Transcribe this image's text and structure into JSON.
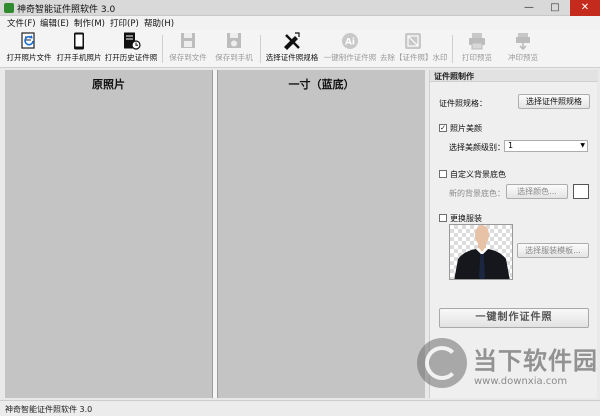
{
  "window": {
    "title": "神奇智能证件照软件 3.0",
    "minimize": "—",
    "maximize": "□",
    "close": "✕"
  },
  "menu": [
    "文件(F)",
    "编辑(E)",
    "制作(M)",
    "打印(P)",
    "帮助(H)"
  ],
  "toolbar": [
    {
      "label": "打开照片文件",
      "icon": "open-photo-file-icon",
      "enabled": true
    },
    {
      "label": "打开手机照片",
      "icon": "phone-icon",
      "enabled": true
    },
    {
      "label": "打开历史证件照",
      "icon": "history-document-icon",
      "enabled": true
    },
    {
      "label": "保存到文件",
      "icon": "floppy-disk-icon",
      "enabled": false
    },
    {
      "label": "保存到手机",
      "icon": "save-to-phone-icon",
      "enabled": false
    },
    {
      "label": "选择证件照规格",
      "icon": "ruler-pencil-icon",
      "enabled": true
    },
    {
      "label": "一键制作证件照",
      "icon": "ai-icon",
      "enabled": false
    },
    {
      "label": "去除【证件照】水印",
      "icon": "remove-watermark-icon",
      "enabled": false
    },
    {
      "label": "打印预览",
      "icon": "printer-icon",
      "enabled": false
    },
    {
      "label": "冲印预览",
      "icon": "print-shop-icon",
      "enabled": false
    }
  ],
  "panes": {
    "left_title": "原照片",
    "middle_title": "一寸（蓝底）"
  },
  "panel": {
    "header": "证件照制作",
    "spec_label": "证件照规格：",
    "spec_button": "选择证件照规格",
    "beauty_label": "照片美颜",
    "beauty_checked": true,
    "beauty_level_label": "选择美颜级别：",
    "beauty_level_value": "1",
    "custom_bg_label": "自定义背景底色",
    "custom_bg_checked": false,
    "new_bg_label": "新的背景底色：",
    "choose_color_button": "选择颜色...",
    "bg_swatch_color": "#ffffff",
    "change_outfit_label": "更换服装",
    "change_outfit_checked": false,
    "choose_outfit_button": "选择服装模板...",
    "make_button": "一键制作证件照"
  },
  "status": "神奇智能证件照软件 3.0",
  "watermark": {
    "name": "当下软件园",
    "url": "www.downxia.com"
  },
  "colors": {
    "close_button": "#c42b1c",
    "pane_background": "#c4c4c4",
    "suit": "#15171c",
    "tie": "#1b2740",
    "skin": "#e8c2a6"
  }
}
